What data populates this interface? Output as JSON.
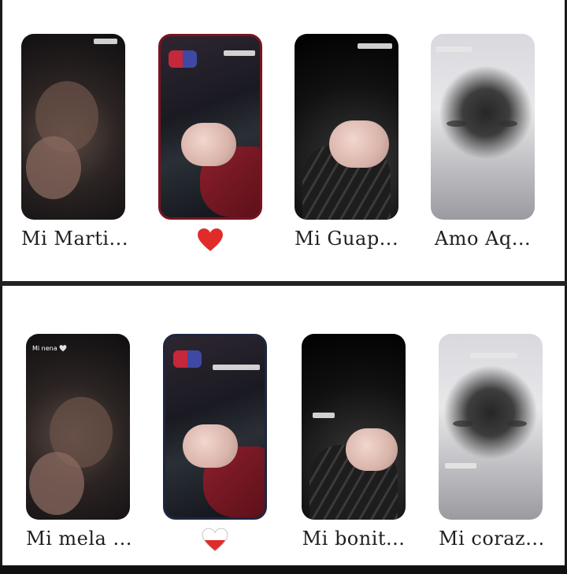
{
  "rows": [
    {
      "cards": [
        {
          "label": "Mi Marti...",
          "style": "dark1"
        },
        {
          "label": "",
          "heart": "red-heart",
          "style": "car"
        },
        {
          "label": "Mi Guap...",
          "style": "black"
        },
        {
          "label": "Amo Aq...",
          "style": "grey"
        }
      ]
    },
    {
      "cards": [
        {
          "label": "Mi mela ...",
          "style": "dark1",
          "overlay": "Mi nena 🤍"
        },
        {
          "label": "",
          "heart": "red-white-heart",
          "style": "car"
        },
        {
          "label": "Mi bonit...",
          "style": "black"
        },
        {
          "label": "Mi coraz...",
          "style": "grey"
        }
      ]
    }
  ],
  "colors": {
    "heart_red": "#e02b2b",
    "panel_bg": "#ffffff",
    "separator": "#1a1a1a"
  }
}
